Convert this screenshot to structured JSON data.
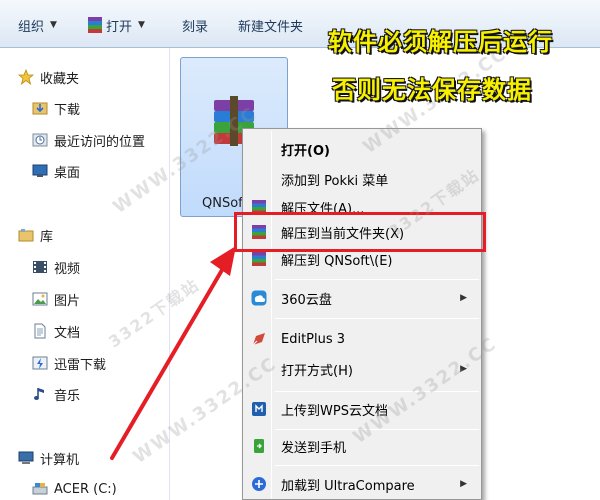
{
  "toolbar": {
    "organize": "组织",
    "open": "打开",
    "burn": "刻录",
    "new_folder": "新建文件夹"
  },
  "banner": {
    "line1": "软件必须解压后运行",
    "line2": "否则无法保存数据"
  },
  "nav": {
    "favorites": "收藏夹",
    "downloads": "下载",
    "recent": "最近访问的位置",
    "desktop": "桌面",
    "libraries": "库",
    "videos": "视频",
    "pictures": "图片",
    "documents": "文档",
    "thunder": "迅雷下载",
    "music": "音乐",
    "computer": "计算机",
    "acer": "ACER (C:)"
  },
  "file": {
    "name": "QNSoft"
  },
  "menu": {
    "open": "打开(O)",
    "pokki": "添加到 Pokki 菜单",
    "extract": "解压文件(A)...",
    "extract_here": "解压到当前文件夹(X)",
    "extract_to": "解压到 QNSoft\\(E)",
    "cloud360": "360云盘",
    "editplus": "EditPlus 3",
    "open_with": "打开方式(H)",
    "wps": "上传到WPS云文档",
    "send_phone": "发送到手机",
    "ultracompare": "加载到 UltraCompare"
  },
  "watermark": "WWW.3322.CC",
  "watermark_cn": "3322下载站",
  "colors": {
    "highlight": "#e51e26",
    "banner": "#f7f000",
    "arrow": "#e51e26"
  }
}
